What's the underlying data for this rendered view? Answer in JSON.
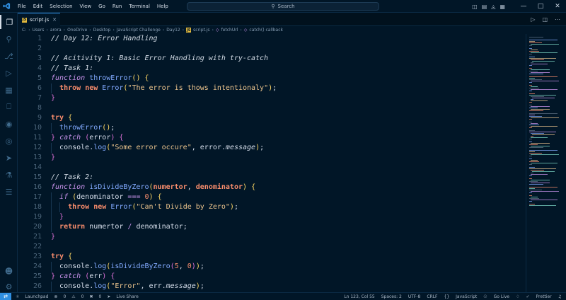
{
  "menubar": [
    "File",
    "Edit",
    "Selection",
    "View",
    "Go",
    "Run",
    "Terminal",
    "Help"
  ],
  "command_center": {
    "placeholder": "Search"
  },
  "tab": {
    "label": "script.js",
    "badge": "JS"
  },
  "breadcrumb": [
    "C:",
    "Users",
    "arora",
    "OneDrive",
    "Desktop",
    "JavaScript Challenge",
    "Day12",
    "script.js",
    "fetchUrl",
    "catch() callback"
  ],
  "code_lines": [
    {
      "n": "1",
      "text": "// Day 12: Error Handling"
    },
    {
      "n": "2",
      "text": ""
    },
    {
      "n": "3",
      "text": "// Acitivity 1: Basic Error Handling with try-catch"
    },
    {
      "n": "4",
      "text": "// Task 1:"
    },
    {
      "n": "5",
      "text": "function throwError() {"
    },
    {
      "n": "6",
      "text": "  throw new Error(\"The error is thows intentionaly\");"
    },
    {
      "n": "7",
      "text": "}"
    },
    {
      "n": "8",
      "text": ""
    },
    {
      "n": "9",
      "text": "try {"
    },
    {
      "n": "10",
      "text": "  throwError();"
    },
    {
      "n": "11",
      "text": "} catch (error) {"
    },
    {
      "n": "12",
      "text": "  console.log(\"Some error occure\", error.message);"
    },
    {
      "n": "13",
      "text": "}"
    },
    {
      "n": "14",
      "text": ""
    },
    {
      "n": "15",
      "text": "// Task 2:"
    },
    {
      "n": "16",
      "text": "function isDivideByZero(numertor, denominator) {"
    },
    {
      "n": "17",
      "text": "  if (denominator === 0) {"
    },
    {
      "n": "18",
      "text": "    throw new Error(\"Can't Divide by Zero\");"
    },
    {
      "n": "19",
      "text": "  }"
    },
    {
      "n": "20",
      "text": "  return numertor / denominator;"
    },
    {
      "n": "21",
      "text": "}"
    },
    {
      "n": "22",
      "text": ""
    },
    {
      "n": "23",
      "text": "try {"
    },
    {
      "n": "24",
      "text": "  console.log(isDivideByZero(5, 0));"
    },
    {
      "n": "25",
      "text": "} catch (err) {"
    },
    {
      "n": "26",
      "text": "  console.log(\"Error\", err.message);"
    }
  ],
  "status": {
    "branch_icon": "launchpad-icon",
    "launchpad": "Launchpad",
    "errors": "0",
    "warnings": "0",
    "ports": "0",
    "live_share": "Live Share",
    "position": "Ln 123, Col 55",
    "spaces": "Spaces: 2",
    "encoding": "UTF-8",
    "eol": "CRLF",
    "language": "JavaScript",
    "go_live": "Go Live",
    "prettier": "Prettier"
  },
  "colors": {
    "background": "#011627",
    "accent": "#2f8ee0",
    "keyword": "#c792ea",
    "string": "#ecc48d",
    "function": "#82aaff",
    "control": "#f78c6c"
  }
}
